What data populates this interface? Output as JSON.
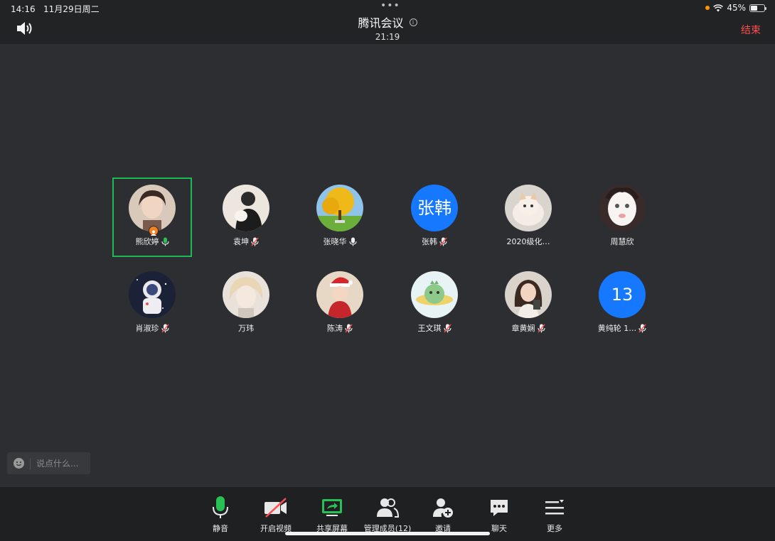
{
  "status_bar": {
    "time": "14:16",
    "date": "11月29日周二",
    "battery": "45%"
  },
  "meeting": {
    "title": "腾讯会议",
    "duration": "21:19",
    "end_label": "结束"
  },
  "participants": [
    {
      "name": "熊欣婷",
      "mic": "on",
      "active": true,
      "host": true,
      "avatar": "photo-woman"
    },
    {
      "name": "袁坤",
      "mic": "muted",
      "avatar": "photo-man-cat"
    },
    {
      "name": "张晓华",
      "mic": "on-white",
      "avatar": "photo-tree"
    },
    {
      "name": "张韩",
      "mic": "muted",
      "avatar_text": "张韩"
    },
    {
      "name": "2020级化…",
      "mic": "none",
      "avatar": "photo-cat"
    },
    {
      "name": "周慧欣",
      "mic": "none",
      "avatar": "photo-mask"
    },
    {
      "name": "肖淑珍",
      "mic": "muted",
      "avatar": "photo-astronaut"
    },
    {
      "name": "万玮",
      "mic": "none",
      "avatar": "photo-anime"
    },
    {
      "name": "陈涛",
      "mic": "muted",
      "avatar": "photo-child"
    },
    {
      "name": "王文琪",
      "mic": "muted",
      "avatar": "photo-dino"
    },
    {
      "name": "章黄娴",
      "mic": "muted",
      "avatar": "photo-girl"
    },
    {
      "name": "黄纯轮 1…",
      "mic": "muted",
      "avatar_text": "13"
    }
  ],
  "chat": {
    "placeholder": "说点什么..."
  },
  "toolbar": [
    {
      "label": "静音",
      "icon": "mic-icon"
    },
    {
      "label": "开启视频",
      "icon": "camera-off-icon"
    },
    {
      "label": "共享屏幕",
      "icon": "share-screen-icon"
    },
    {
      "label": "管理成员(12)",
      "icon": "members-icon"
    },
    {
      "label": "邀请",
      "icon": "invite-icon"
    },
    {
      "label": "聊天",
      "icon": "chat-icon"
    },
    {
      "label": "更多",
      "icon": "more-icon"
    }
  ],
  "colors": {
    "accent_green": "#1db954",
    "end_red": "#ff4d4f",
    "avatar_blue": "#1677ff",
    "host_orange": "#f58220"
  }
}
